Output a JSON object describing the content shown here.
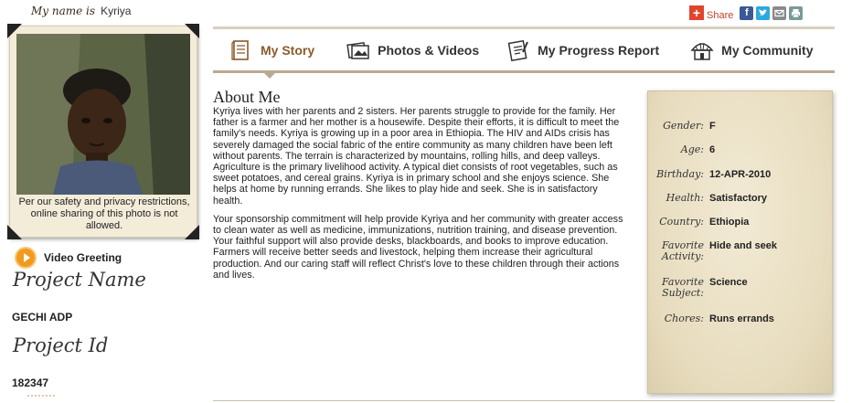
{
  "header": {
    "my_name_label": "My name is",
    "child_name": "Kyriya"
  },
  "share": {
    "label": "Share",
    "plus": "+",
    "icons": [
      "facebook-icon",
      "twitter-icon",
      "email-icon",
      "print-icon"
    ]
  },
  "photo": {
    "caption": "Per our safety and privacy restrictions, online sharing of this photo is not allowed."
  },
  "video": {
    "label": "Video Greeting"
  },
  "project": {
    "name_label": "Project Name",
    "name_value": "GECHI ADP",
    "id_label": "Project Id",
    "id_value": "182347"
  },
  "nav": {
    "tabs": [
      {
        "label": "My Story",
        "icon": "book-icon",
        "active": true
      },
      {
        "label": "Photos & Videos",
        "icon": "photos-icon",
        "active": false
      },
      {
        "label": "My Progress Report",
        "icon": "report-icon",
        "active": false
      },
      {
        "label": "My Community",
        "icon": "hut-icon",
        "active": false
      }
    ]
  },
  "about": {
    "title": "About Me",
    "paragraphs": [
      "Kyriya lives with her parents and 2 sisters. Her parents struggle to provide for the family. Her father is a farmer and her mother is a housewife. Despite their efforts, it is difficult to meet the family's needs. Kyriya is growing up in a poor area in Ethiopia. The HIV and AIDs crisis has severely damaged the social fabric of the entire community as many children have been left without parents. The terrain is characterized by mountains, rolling hills, and deep valleys. Agriculture is the primary livelihood activity. A typical diet consists of root vegetables, such as sweet potatoes, and cereal grains. Kyriya is in primary school and she enjoys science. She helps at home by running errands. She likes to play hide and seek. She is in satisfactory health.",
      "Your sponsorship commitment will help provide Kyriya and her community with greater access to clean water as well as medicine, immunizations, nutrition training, and disease prevention. Your faithful support will also provide desks, blackboards, and books to improve education. Farmers will receive better seeds and livestock, helping them increase their agricultural production. And our caring staff will reflect Christ's love to these children through their actions and lives."
    ]
  },
  "facts": {
    "gender": {
      "label": "Gender:",
      "value": "F"
    },
    "age": {
      "label": "Age:",
      "value": "6"
    },
    "birthday": {
      "label": "Birthday:",
      "value": "12-APR-2010"
    },
    "health": {
      "label": "Health:",
      "value": "Satisfactory"
    },
    "country": {
      "label": "Country:",
      "value": "Ethiopia"
    },
    "activity": {
      "label_line1": "Favorite",
      "label_line2": "Activity:",
      "value": "Hide and seek"
    },
    "subject": {
      "label_line1": "Favorite",
      "label_line2": "Subject:",
      "value": "Science"
    },
    "chores": {
      "label": "Chores:",
      "value": "Runs errands"
    }
  },
  "colors": {
    "accent_brown": "#8b5a2b",
    "play_orange": "#f19a1e",
    "share_red": "#e0452c"
  }
}
